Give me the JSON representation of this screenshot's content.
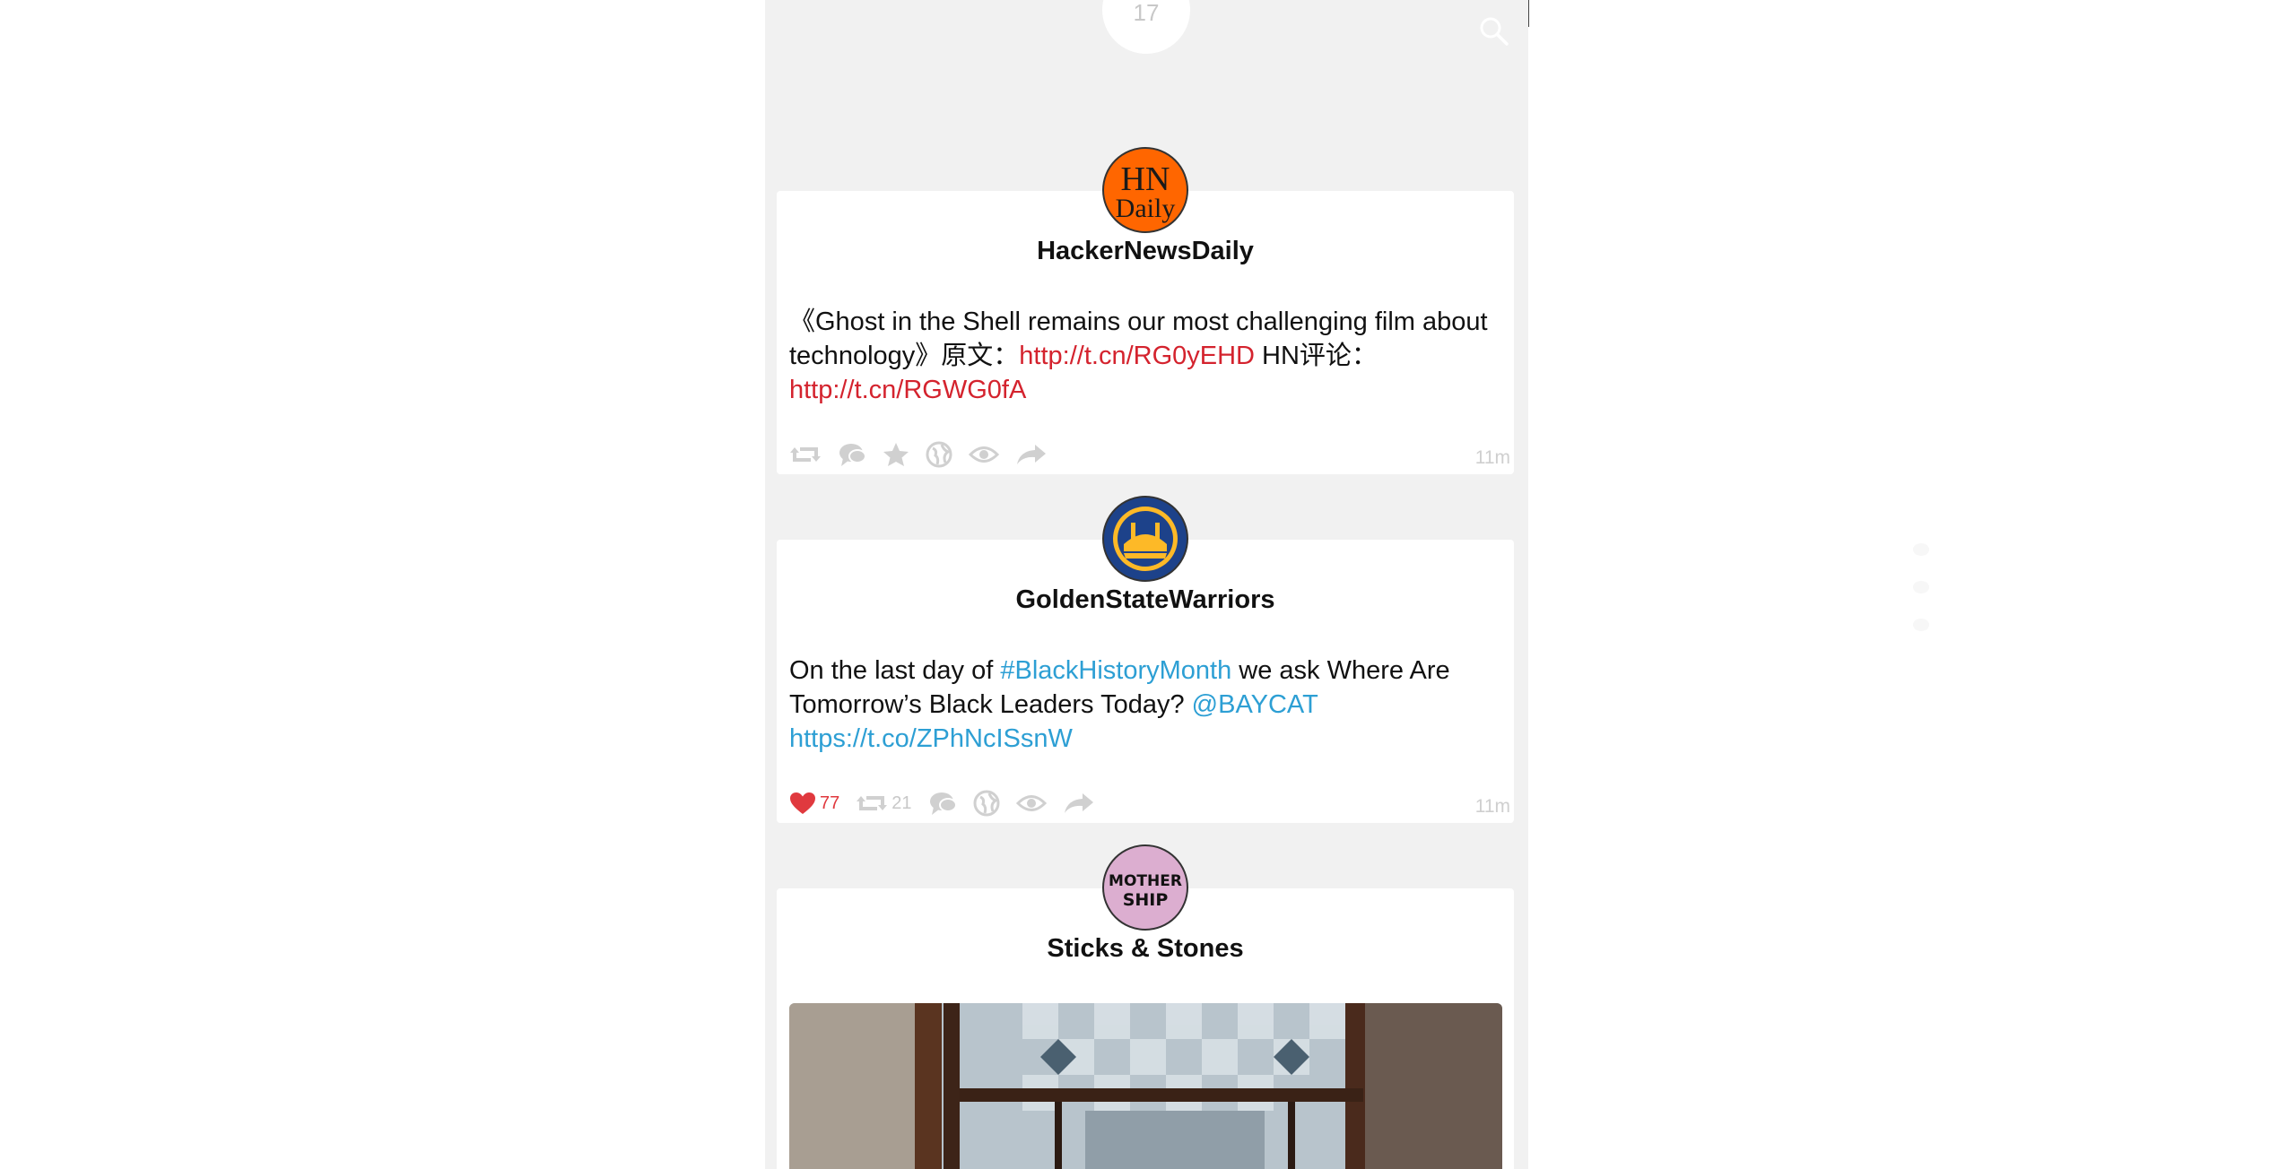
{
  "header": {
    "unread_count": "17",
    "search_icon": "search-icon"
  },
  "tweets": [
    {
      "user": "HackerNewsDaily",
      "avatar_text_line1": "HN",
      "avatar_text_line2": "Daily",
      "text_1": "《Ghost in the Shell remains our most challenging film about technology》原文：",
      "link_1": "http://t.cn/RG0yEHD",
      "text_2": " HN评论：",
      "link_2": "http://t.cn/RGWG0fA",
      "time": "11m"
    },
    {
      "user": "GoldenStateWarriors",
      "text_1": "On the last day of ",
      "hashtag": "#BlackHistoryMonth",
      "text_2": " we ask Where Are Tomorrow’s Black Leaders Today? ",
      "mention": "@BAYCAT",
      "link": "https://t.co/ZPhNcISsnW",
      "likes": "77",
      "retweets": "21",
      "time": "11m"
    },
    {
      "user": "Sticks & Stones",
      "avatar_text_line1": "MOTHER",
      "avatar_text_line2": "SHIP"
    }
  ],
  "colors": {
    "link_red": "#d4232e",
    "link_blue": "#2d9fd4",
    "like_red": "#e0393e",
    "icon_gray": "#d0d0d0",
    "hn_orange": "#ff6600"
  }
}
